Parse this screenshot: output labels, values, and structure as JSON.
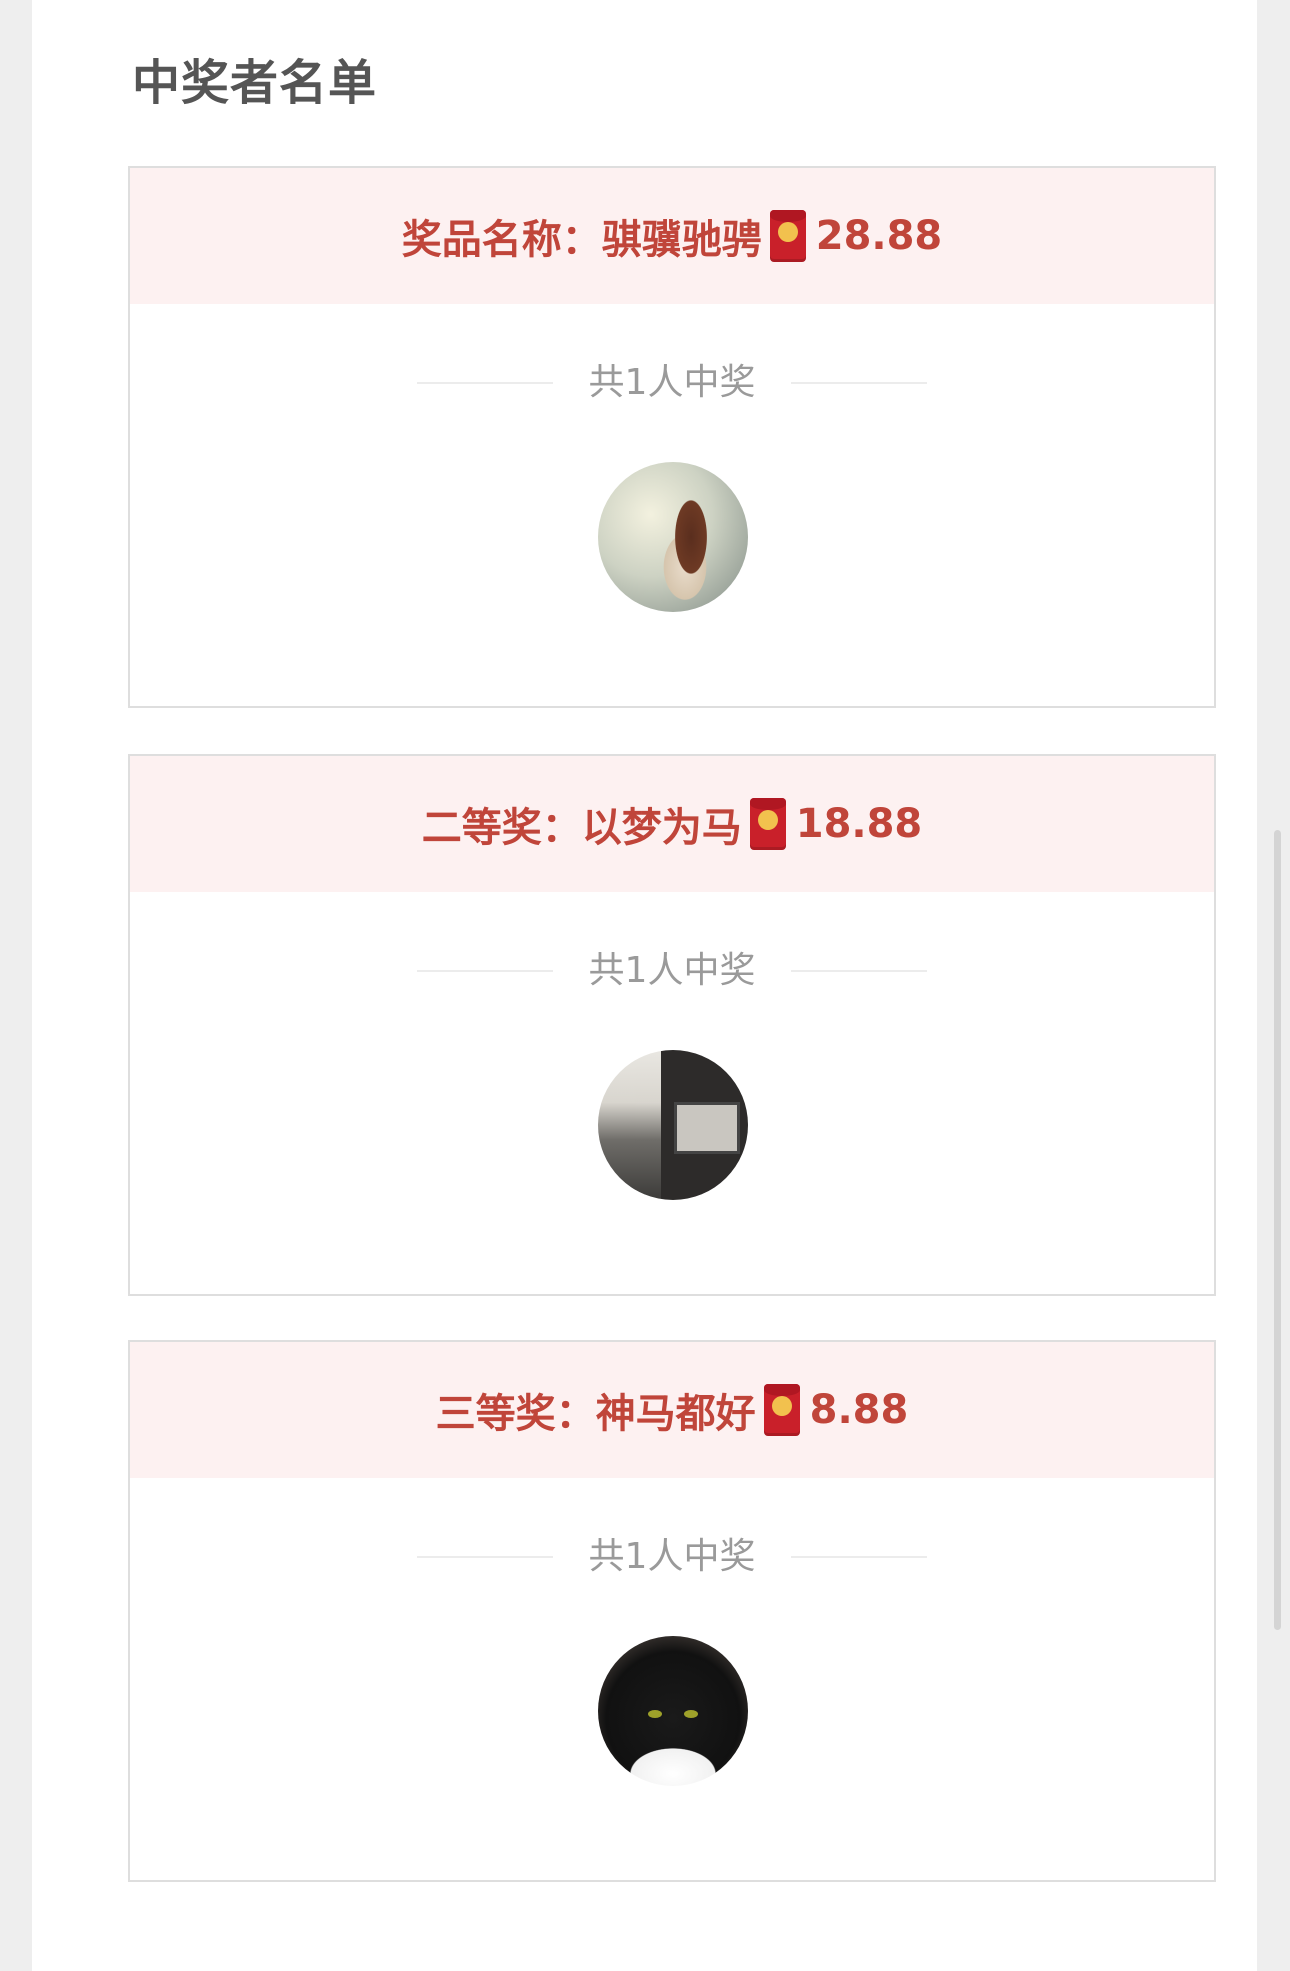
{
  "section": {
    "title": "中奖者名单"
  },
  "prizes": [
    {
      "label": "奖品名称：骐骥驰骋",
      "amount": "28.88",
      "winner_count": "共1人中奖",
      "avatar_icon": "red-envelope-icon"
    },
    {
      "label": "二等奖：以梦为马",
      "amount": "18.88",
      "winner_count": "共1人中奖",
      "avatar_icon": "red-envelope-icon"
    },
    {
      "label": "三等奖：神马都好",
      "amount": "8.88",
      "winner_count": "共1人中奖",
      "avatar_icon": "red-envelope-icon"
    }
  ],
  "colors": {
    "accent": "#c0453a",
    "header_bg": "#fdf1f1",
    "muted_text": "#9a9a9a",
    "title_text": "#555555"
  }
}
